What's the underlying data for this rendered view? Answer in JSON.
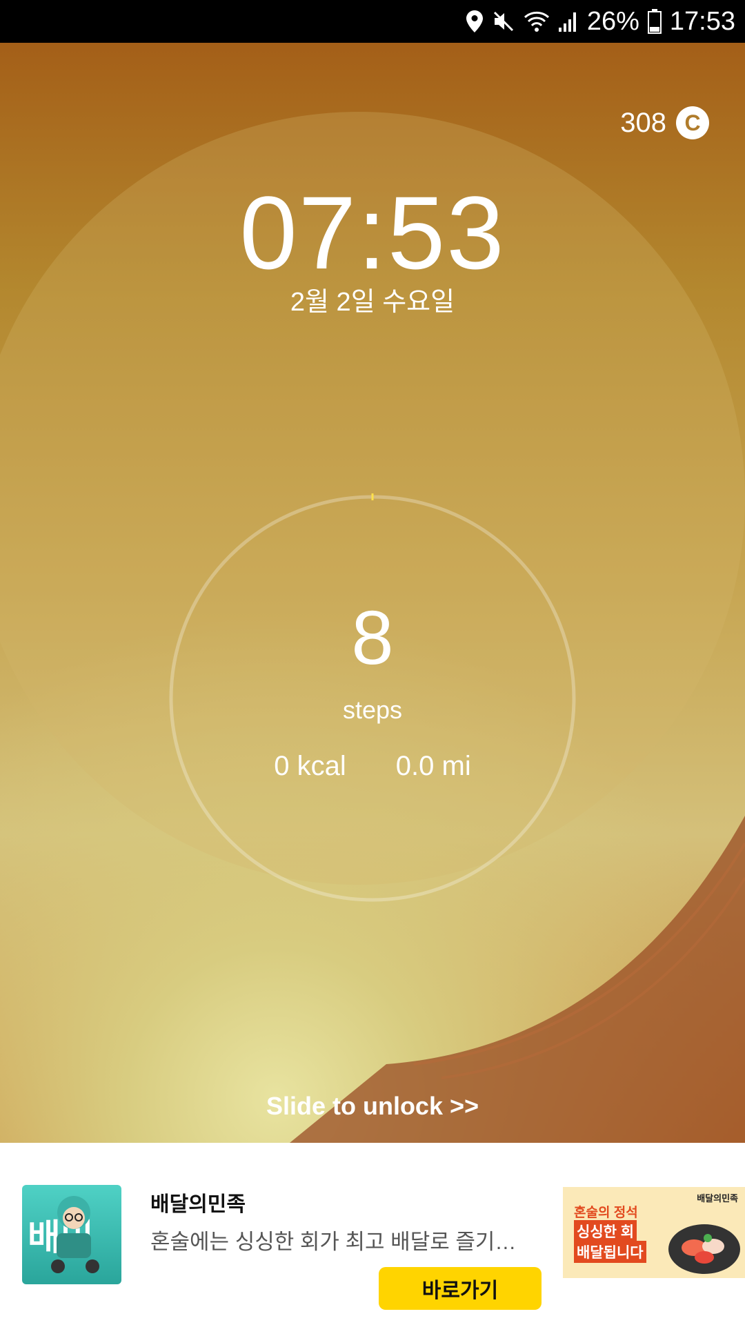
{
  "status_bar": {
    "battery_percent": "26%",
    "time": "17:53",
    "icons": [
      "location-icon",
      "mute-icon",
      "wifi-icon",
      "signal-icon",
      "battery-icon"
    ]
  },
  "lockscreen": {
    "coins": "308",
    "coin_symbol": "C",
    "clock": "07:53",
    "date": "2월 2일 수요일",
    "steps": "8",
    "steps_label": "steps",
    "kcal": "0 kcal",
    "distance": "0.0 mi",
    "unlock_hint": "Slide to unlock >>"
  },
  "ad": {
    "title": "배달의민족",
    "description": "혼술에는 싱싱한 회가 최고 배달로 즐기는 ...",
    "button": "바로가기",
    "icon_text": "배민",
    "image": {
      "brand": "배달의민족",
      "line1": "혼술의 정석",
      "line2": "싱싱한 회",
      "line3": "배달됩니다"
    }
  }
}
